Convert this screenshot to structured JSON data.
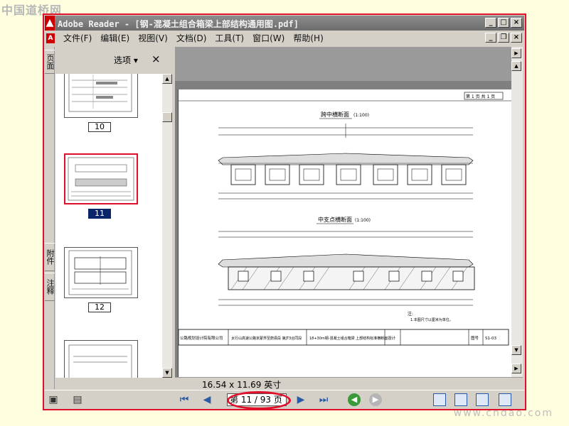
{
  "watermarks": {
    "top": "中国道桥网",
    "bottom": "www.cndao.com"
  },
  "window": {
    "app_icon": "adobe-reader-logo",
    "title": "Adobe Reader - [钢-混凝土组合箱梁上部结构通用图.pdf]",
    "controls": {
      "minimize": "_",
      "maximize": "□",
      "close": "×"
    },
    "doc_controls": {
      "minimize": "_",
      "restore": "❐",
      "close": "×"
    }
  },
  "menu": {
    "items": [
      "文件(F)",
      "编辑(E)",
      "视图(V)",
      "文档(D)",
      "工具(T)",
      "窗口(W)",
      "帮助(H)"
    ]
  },
  "side_tabs": [
    "页面",
    "附件",
    "注释"
  ],
  "thumbnail_panel": {
    "options_label": "选项 ▾",
    "close_label": "×",
    "thumbnails": [
      {
        "label": "10",
        "selected": false
      },
      {
        "label": "11",
        "selected": true
      },
      {
        "label": "12",
        "selected": false
      },
      {
        "label": "",
        "selected": false
      }
    ]
  },
  "document": {
    "page_corner": "第 1 页 共 1 页",
    "section1_title": "跨中横断面",
    "section1_scale": "(1:100)",
    "section2_title": "中支点横断面",
    "section2_scale": "(1:100)",
    "note": "注:",
    "note_text": "1.本图尺寸以厘米为单位。",
    "footer_company": "公路规划设计院有限公司",
    "footer_project": "太行山高速公路京蒙界至蔚县段 第JT3合同段",
    "footer_title": "18+30m钢-混凝土组合箱梁 上部结构标准横断面",
    "footer_design": "设计",
    "footer_sheet_label": "图号",
    "footer_sheet_no": "S1-03",
    "page_size": "16.54 x 11.69 英寸"
  },
  "navigation": {
    "current_page": "11",
    "total_pages": "93",
    "page_text": "第 11 / 93 页",
    "first_icon": "first-page-icon",
    "prev_icon": "prev-page-icon",
    "next_icon": "next-page-icon",
    "last_icon": "last-page-icon",
    "back_icon": "go-back-icon",
    "forward_icon": "go-forward-icon"
  },
  "colors": {
    "highlight": "#e0102a",
    "titlebar": "#7a7a7a",
    "selection": "#0a246a"
  }
}
